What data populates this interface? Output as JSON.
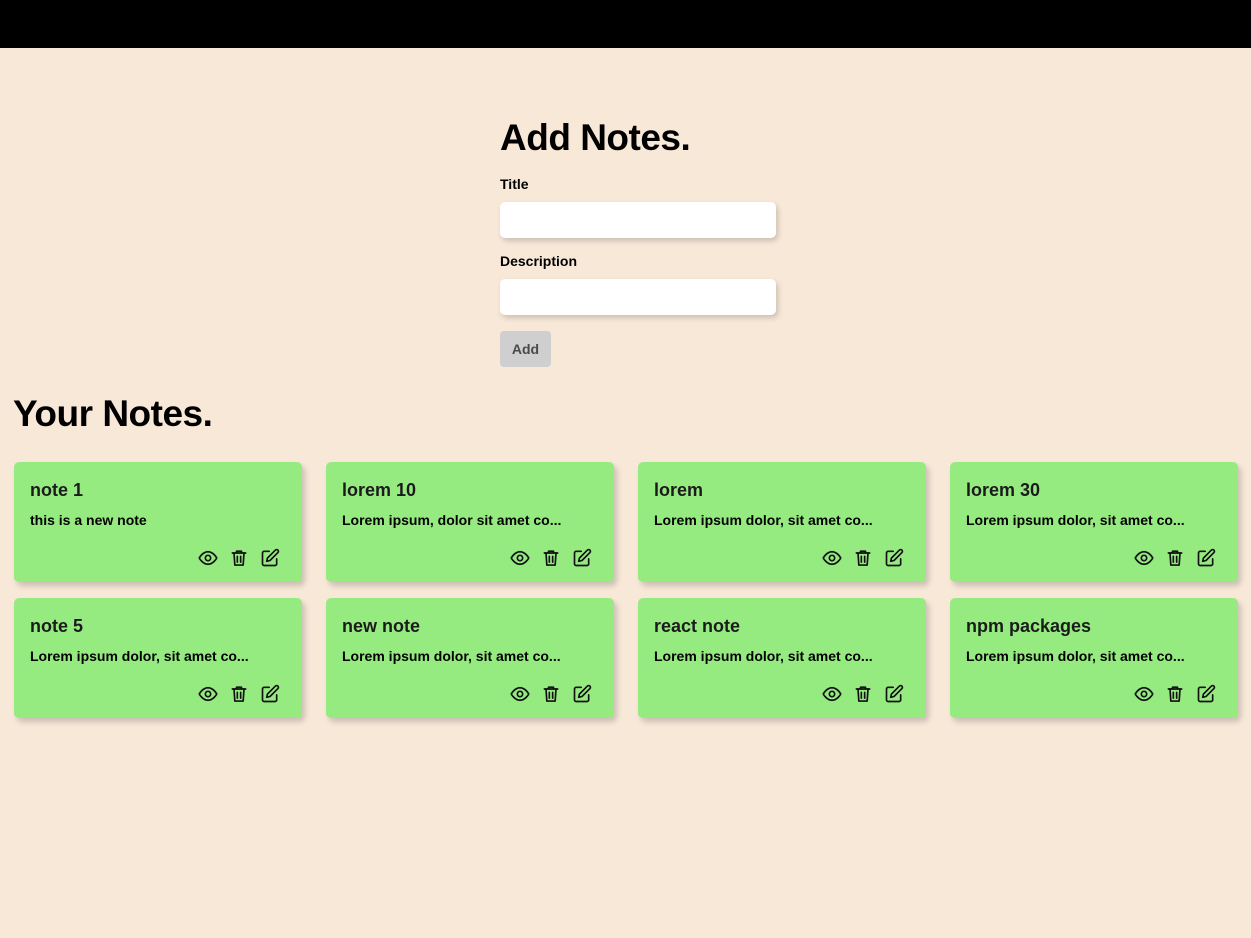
{
  "add_form": {
    "heading": "Add Notes.",
    "title_label": "Title",
    "title_value": "",
    "description_label": "Description",
    "description_value": "",
    "add_button_label": "Add"
  },
  "notes_section": {
    "heading": "Your Notes."
  },
  "notes": [
    {
      "title": "note 1",
      "description": "this is a new note"
    },
    {
      "title": "lorem 10",
      "description": "Lorem ipsum, dolor sit amet co..."
    },
    {
      "title": "lorem",
      "description": "Lorem ipsum dolor, sit amet co..."
    },
    {
      "title": "lorem 30",
      "description": "Lorem ipsum dolor, sit amet co..."
    },
    {
      "title": "note 5",
      "description": "Lorem ipsum dolor, sit amet co..."
    },
    {
      "title": "new note",
      "description": "Lorem ipsum dolor, sit amet co..."
    },
    {
      "title": "react note",
      "description": "Lorem ipsum dolor, sit amet co..."
    },
    {
      "title": "npm packages",
      "description": "Lorem ipsum dolor, sit amet co..."
    }
  ],
  "note_actions": [
    "eye-icon",
    "trash-icon",
    "edit-icon"
  ],
  "colors": {
    "topbar": "#000000",
    "background": "#f8e8d8",
    "card": "#96eb80",
    "add_button_disabled": "#cfcfcf"
  }
}
